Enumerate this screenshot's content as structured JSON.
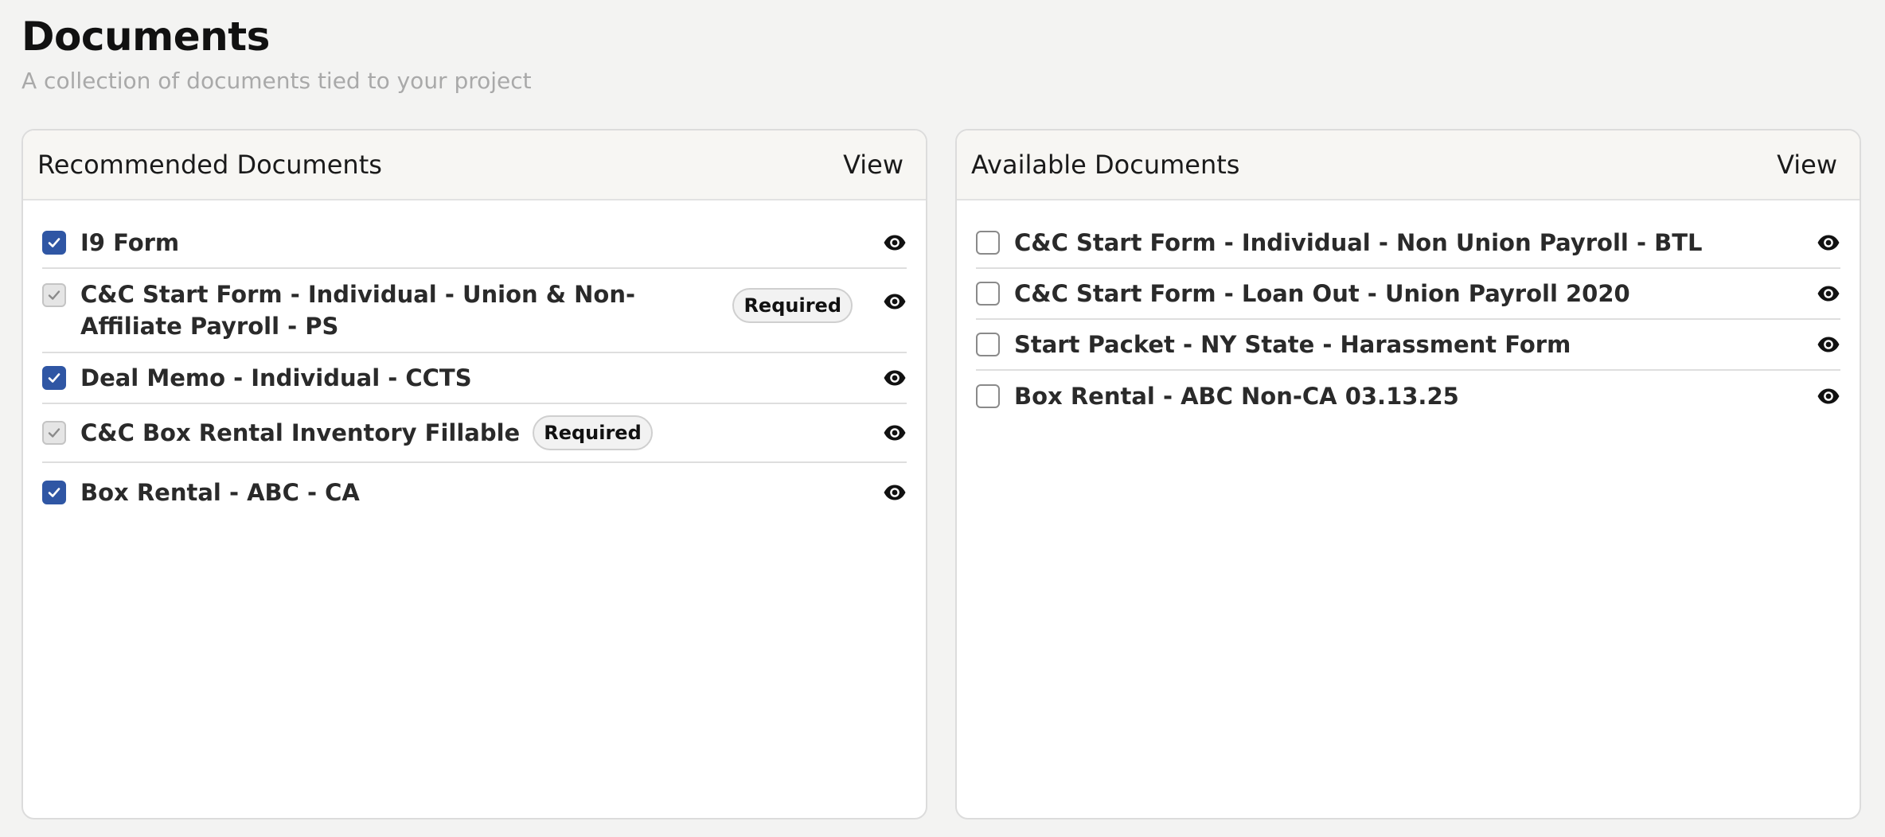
{
  "page": {
    "title": "Documents",
    "subtitle": "A collection of documents tied to your project"
  },
  "recommended": {
    "title": "Recommended Documents",
    "view_label": "View",
    "items": [
      {
        "label": "I9 Form",
        "state": "checked",
        "badge": ""
      },
      {
        "label": "C&C Start Form - Individual - Union & Non-Affiliate Payroll - PS",
        "state": "locked",
        "badge": "Required"
      },
      {
        "label": "Deal Memo - Individual - CCTS",
        "state": "checked",
        "badge": ""
      },
      {
        "label": "C&C Box Rental Inventory Fillable",
        "state": "locked",
        "badge": "Required"
      },
      {
        "label": "Box Rental - ABC - CA",
        "state": "checked",
        "badge": ""
      }
    ]
  },
  "available": {
    "title": "Available Documents",
    "view_label": "View",
    "items": [
      {
        "label": "C&C Start Form - Individual - Non Union Payroll - BTL",
        "state": "unchecked"
      },
      {
        "label": "C&C Start Form - Loan Out - Union Payroll 2020",
        "state": "unchecked"
      },
      {
        "label": "Start Packet - NY State - Harassment Form",
        "state": "unchecked"
      },
      {
        "label": "Box Rental - ABC Non-CA 03.13.25",
        "state": "unchecked"
      }
    ]
  },
  "icons": {
    "checkbox_checked": "check-icon",
    "preview": "eye-icon"
  },
  "colors": {
    "accent": "#2f56a4",
    "locked": "#e5e5e5",
    "subtitle": "#a9a9a9"
  }
}
